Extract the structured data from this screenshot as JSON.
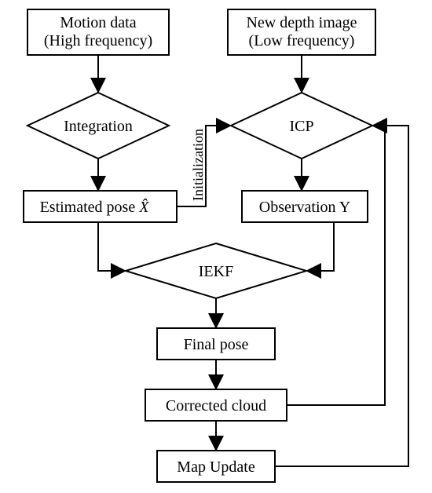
{
  "nodes": {
    "motion": {
      "line1": "Motion data",
      "line2": "(High frequency)"
    },
    "depth": {
      "line1": "New depth image",
      "line2": "(Low frequency)"
    },
    "integration": "Integration",
    "icp": "ICP",
    "est_pose_prefix": "Estimated pose ",
    "est_pose_hat": "X̂",
    "observation": "Observation Y",
    "iekf": "IEKF",
    "final_pose": "Final pose",
    "corrected": "Corrected cloud",
    "map_update": "Map Update"
  },
  "edges": {
    "initialization": "Initialization"
  }
}
